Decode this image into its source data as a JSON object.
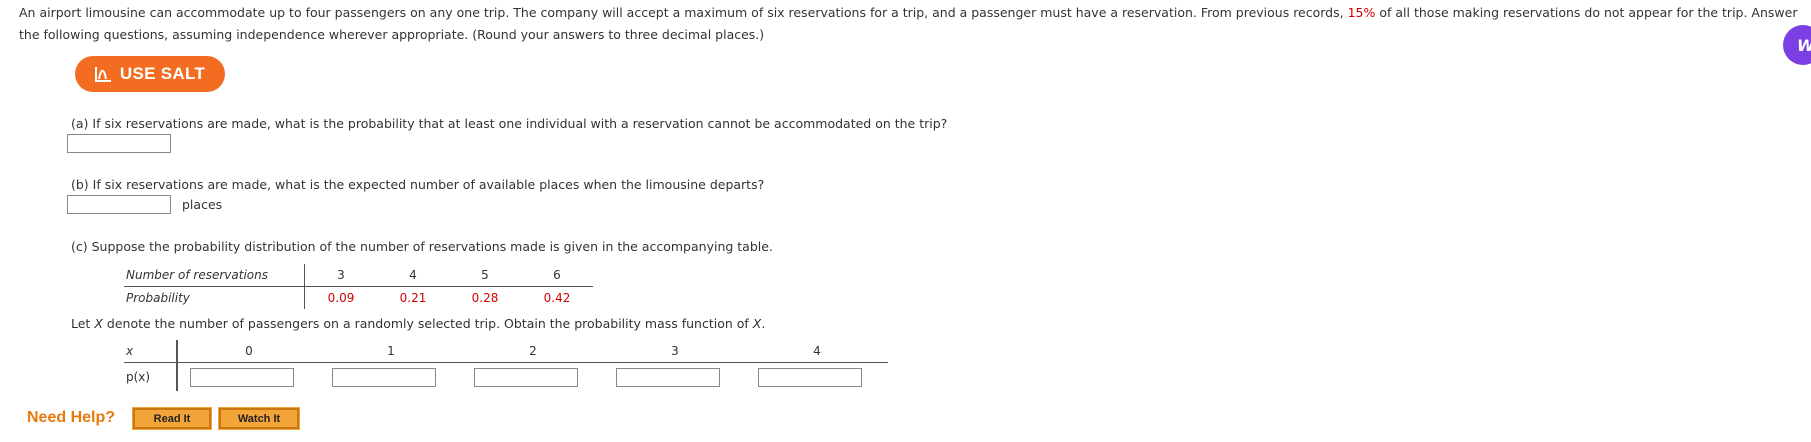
{
  "intro": {
    "part1": "An airport limousine can accommodate up to four passengers on any one trip. The company will accept a maximum of six reservations for a trip, and a passenger must have a reservation. From previous records,",
    "percent": "15%",
    "part2": "of all those making reservations do not appear for the trip. Answer the following questions, assuming independence wherever appropriate. (Round your answers to three decimal places.)"
  },
  "salt_button": {
    "label": "USE SALT",
    "color": "#f26d21"
  },
  "chat_bubble": {
    "glyph": "W",
    "color": "#7b3fe4"
  },
  "questions": {
    "a": {
      "text": "(a) If six reservations are made, what is the probability that at least one individual with a reservation cannot be accommodated on the trip?",
      "value": ""
    },
    "b": {
      "text": "(b) If six reservations are made, what is the expected number of available places when the limousine departs?",
      "value": "",
      "unit": "places"
    },
    "c": {
      "text": "(c) Suppose the probability distribution of the number of reservations made is given in the accompanying table."
    }
  },
  "reservation_table": {
    "row_labels": [
      "Number of reservations",
      "Probability"
    ],
    "values": [
      "3",
      "4",
      "5",
      "6"
    ],
    "probabilities": [
      "0.09",
      "0.21",
      "0.28",
      "0.42"
    ],
    "probability_color": "#d40000"
  },
  "pmf_prompt": {
    "part1": "Let",
    "var": "X",
    "part2": "denote the number of passengers on a randomly selected trip. Obtain the probability mass function of",
    "var2": "X",
    "end": "."
  },
  "pmf_table": {
    "row_labels": [
      "x",
      "p(x)"
    ],
    "x_values": [
      "0",
      "1",
      "2",
      "3",
      "4"
    ]
  },
  "help": {
    "label": "Need Help?",
    "read_it": "Read It",
    "watch_it": "Watch It",
    "color": "#e87a0d"
  }
}
